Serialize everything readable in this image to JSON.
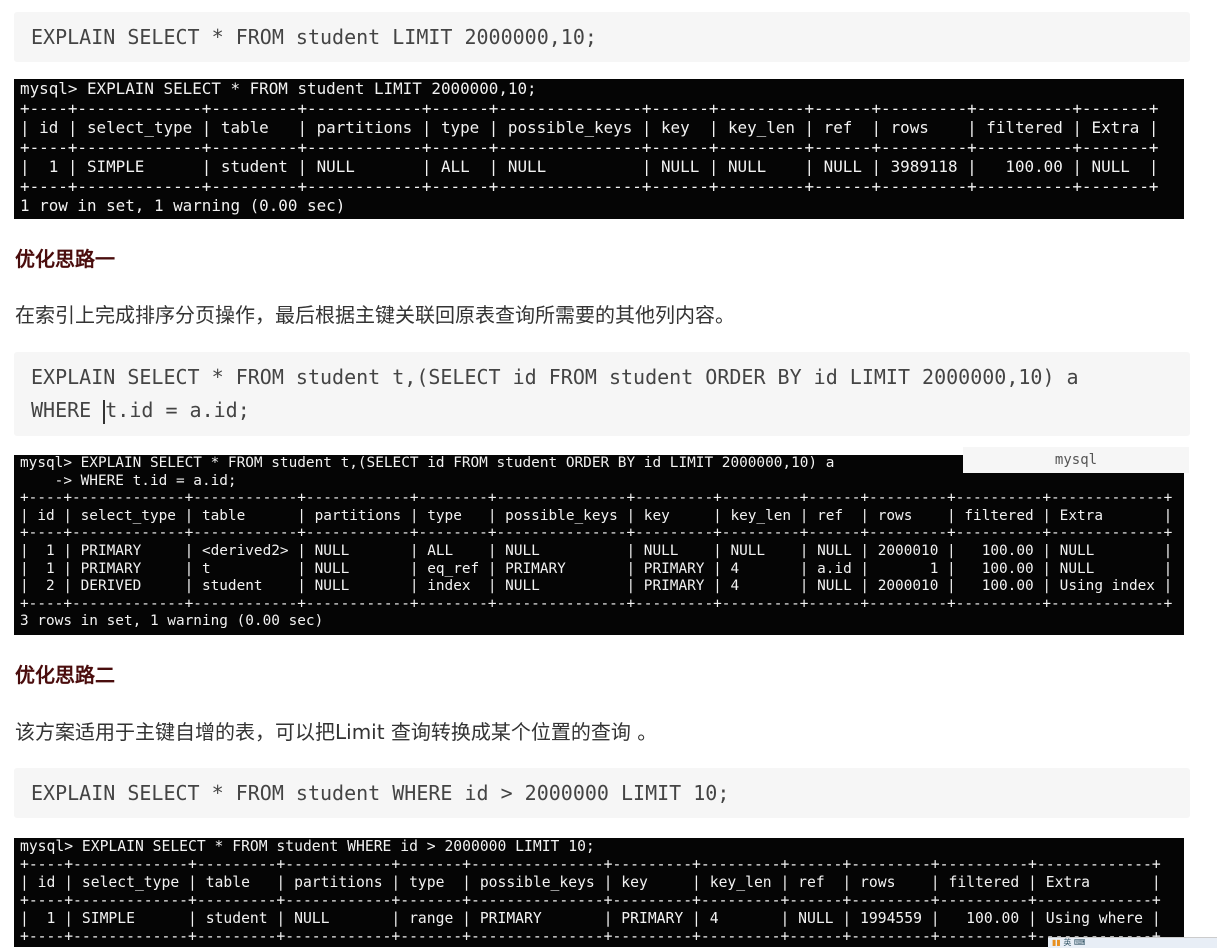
{
  "code_blocks": [
    {
      "lines": [
        "EXPLAIN SELECT * FROM student LIMIT 2000000,10;"
      ]
    },
    {
      "lines": [
        "EXPLAIN SELECT * FROM student t,(SELECT id FROM student ORDER BY id LIMIT 2000000,10) a",
        "t.id = a.id;"
      ],
      "line2_prefix": "WHERE ",
      "language": "mysql"
    },
    {
      "lines": [
        "EXPLAIN SELECT * FROM student WHERE id > 2000000 LIMIT 10;"
      ]
    }
  ],
  "terminals": [
    {
      "lines": [
        "mysql> EXPLAIN SELECT * FROM student LIMIT 2000000,10;",
        "+----+-------------+---------+------------+------+---------------+------+---------+------+---------+----------+-------+",
        "| id | select_type | table   | partitions | type | possible_keys | key  | key_len | ref  | rows    | filtered | Extra |",
        "+----+-------------+---------+------------+------+---------------+------+---------+------+---------+----------+-------+",
        "|  1 | SIMPLE      | student | NULL       | ALL  | NULL          | NULL | NULL    | NULL | 3989118 |   100.00 | NULL  |",
        "+----+-------------+---------+------------+------+---------------+------+---------+------+---------+----------+-------+",
        "1 row in set, 1 warning (0.00 sec)"
      ]
    },
    {
      "lines": [
        "mysql> EXPLAIN SELECT * FROM student t,(SELECT id FROM student ORDER BY id LIMIT 2000000,10) a",
        "    -> WHERE t.id = a.id;",
        "+----+-------------+------------+------------+--------+---------------+---------+---------+------+---------+----------+-------------+",
        "| id | select_type | table      | partitions | type   | possible_keys | key     | key_len | ref  | rows    | filtered | Extra       |",
        "+----+-------------+------------+------------+--------+---------------+---------+---------+------+---------+----------+-------------+",
        "|  1 | PRIMARY     | <derived2> | NULL       | ALL    | NULL          | NULL    | NULL    | NULL | 2000010 |   100.00 | NULL        |",
        "|  1 | PRIMARY     | t          | NULL       | eq_ref | PRIMARY       | PRIMARY | 4       | a.id |       1 |   100.00 | NULL        |",
        "|  2 | DERIVED     | student    | NULL       | index  | NULL          | PRIMARY | 4       | NULL | 2000010 |   100.00 | Using index |",
        "+----+-------------+------------+------------+--------+---------------+---------+---------+------+---------+----------+-------------+",
        "3 rows in set, 1 warning (0.00 sec)"
      ]
    },
    {
      "lines": [
        "mysql> EXPLAIN SELECT * FROM student WHERE id > 2000000 LIMIT 10;",
        "+----+-------------+---------+------------+-------+---------------+---------+---------+------+---------+----------+-------------+",
        "| id | select_type | table   | partitions | type  | possible_keys | key     | key_len | ref  | rows    | filtered | Extra       |",
        "+----+-------------+---------+------------+-------+---------------+---------+---------+------+---------+----------+-------------+",
        "|  1 | SIMPLE      | student | NULL       | range | PRIMARY       | PRIMARY | 4       | NULL | 1994559 |   100.00 | Using where |",
        "+----+-------------+---------+------------+-------+---------------+---------+---------+------+---------+----------+-------------+"
      ]
    }
  ],
  "sections": [
    {
      "heading": "优化思路一",
      "text": "在索引上完成排序分页操作，最后根据主键关联回原表查询所需要的其他列内容。"
    },
    {
      "heading": "优化思路二",
      "text": "该方案适用于主键自增的表，可以把Limit 查询转换成某个位置的查询 。"
    }
  ],
  "tray": {
    "text": "英"
  }
}
